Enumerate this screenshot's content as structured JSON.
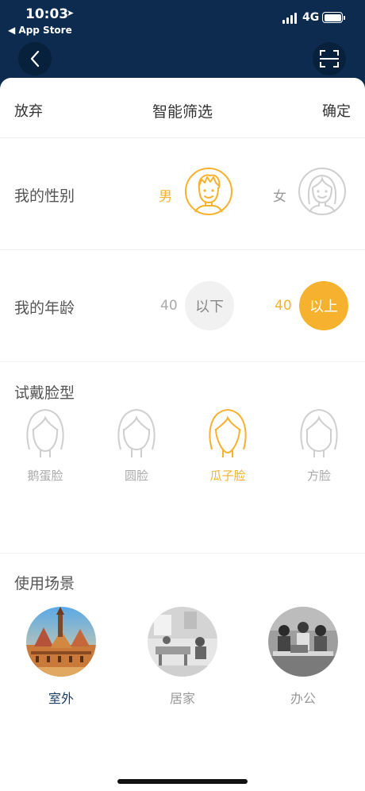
{
  "status_bar": {
    "time": "10:03",
    "back_app": "◀ App Store",
    "network": "4G"
  },
  "sheet": {
    "cancel_label": "放弃",
    "title": "智能筛选",
    "confirm_label": "确定"
  },
  "gender": {
    "label": "我的性别",
    "male_label": "男",
    "female_label": "女",
    "selected": "male"
  },
  "age": {
    "label": "我的年龄",
    "below_number": "40",
    "below_label": "以下",
    "above_number": "40",
    "above_label": "以上",
    "selected": "above"
  },
  "face_shape": {
    "label": "试戴脸型",
    "options": [
      {
        "label": "鹅蛋脸",
        "selected": false
      },
      {
        "label": "圆脸",
        "selected": false
      },
      {
        "label": "瓜子脸",
        "selected": true
      },
      {
        "label": "方脸",
        "selected": false
      }
    ]
  },
  "scene": {
    "label": "使用场景",
    "options": [
      {
        "label": "室外",
        "selected": true
      },
      {
        "label": "居家",
        "selected": false
      },
      {
        "label": "办公",
        "selected": false
      }
    ]
  },
  "colors": {
    "accent": "#f6b22e",
    "nav_bg": "#0c2b4e",
    "text_primary": "#333333",
    "text_muted": "#aaaaaa",
    "scene_selected": "#1c3d66"
  }
}
